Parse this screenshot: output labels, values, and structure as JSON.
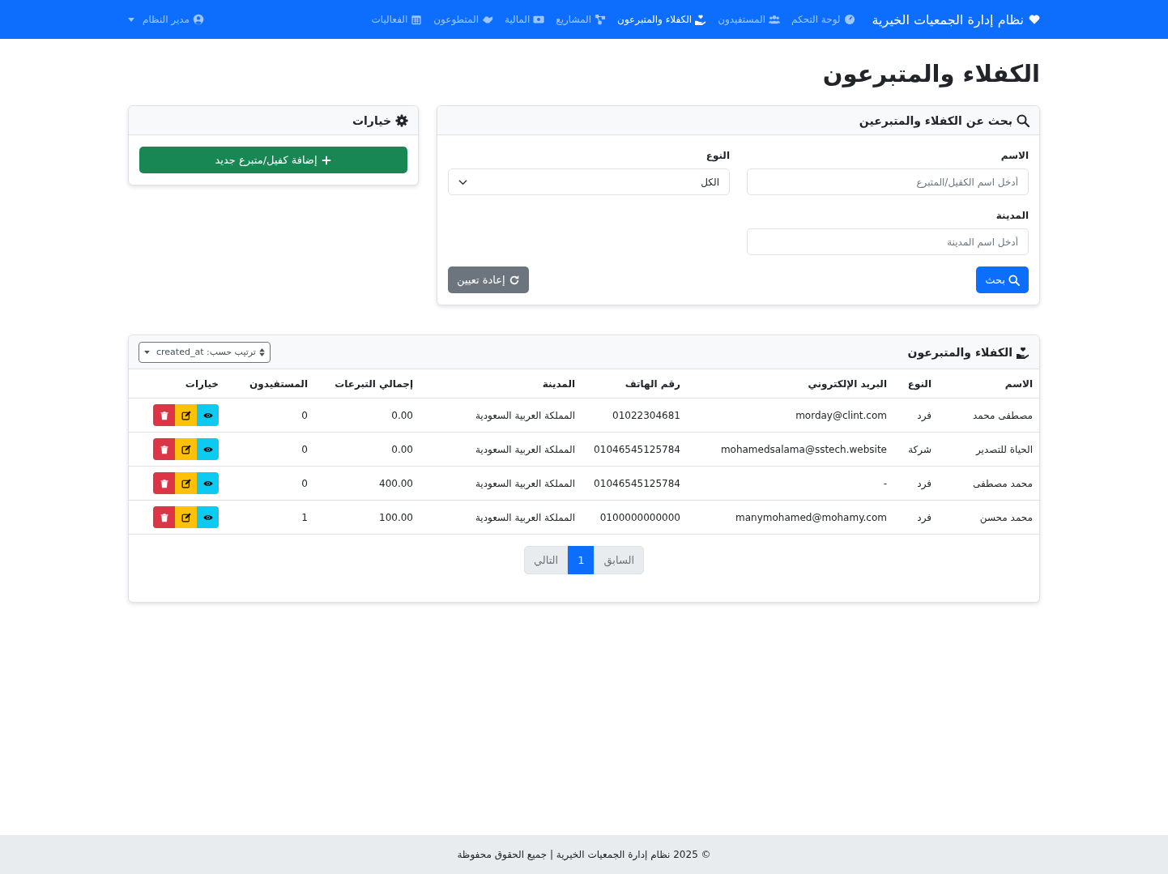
{
  "navbar": {
    "brand": "نظام إدارة الجمعيات الخيرية",
    "items": [
      {
        "label": "لوحة التحكم",
        "selected": false
      },
      {
        "label": "المستفيدون",
        "selected": false
      },
      {
        "label": "الكفلاء والمتبرعون",
        "selected": true
      },
      {
        "label": "المشاريع",
        "selected": false
      },
      {
        "label": "المالية",
        "selected": false
      },
      {
        "label": "المتطوعون",
        "selected": false
      },
      {
        "label": "الفعاليات",
        "selected": false
      }
    ],
    "user": "مدير النظام"
  },
  "page_title": "الكفلاء والمتبرعون",
  "search_card": {
    "title": "بحث عن الكفلاء والمتبرعين",
    "name_field": {
      "label": "الاسم",
      "placeholder": "أدخل اسم الكفيل/المتبرع"
    },
    "type_field": {
      "label": "النوع",
      "value": "الكل"
    },
    "city_field": {
      "label": "المدينة",
      "placeholder": "أدخل اسم المدينة"
    },
    "search_button": "بحث",
    "reset_button": "إعادة تعيين"
  },
  "options_card": {
    "title": "خيارات",
    "add_button": "إضافة كفيل/متبرع جديد"
  },
  "table_card": {
    "title": "الكفلاء والمتبرعون",
    "sort_select": "ترتيب حسب: created_at",
    "columns": [
      "الاسم",
      "النوع",
      "البريد الإلكتروني",
      "رقم الهاتف",
      "المدينة",
      "إجمالي التبرعات",
      "المستفيدون",
      "خيارات"
    ],
    "rows": [
      {
        "name": "مصطفى محمد",
        "type": "فرد",
        "email": "morday@clint.com",
        "phone": "01022304681",
        "city": "المملكة العربية السعودية",
        "total": "0.00",
        "beneficiaries": "0"
      },
      {
        "name": "الحياة للتصدير",
        "type": "شركة",
        "email": "mohamedsalama@sstech.website",
        "phone": "01046545125784",
        "city": "المملكة العربية السعودية",
        "total": "0.00",
        "beneficiaries": "0"
      },
      {
        "name": "محمد مصطفى",
        "type": "فرد",
        "email": "-",
        "phone": "01046545125784",
        "city": "المملكة العربية السعودية",
        "total": "400.00",
        "beneficiaries": "0"
      },
      {
        "name": "محمد محسن",
        "type": "فرد",
        "email": "manymohamed@mohamy.com",
        "phone": "0100000000000",
        "city": "المملكة العربية السعودية",
        "total": "100.00",
        "beneficiaries": "1"
      }
    ],
    "pagination": [
      {
        "label": "السابق",
        "selected": false
      },
      {
        "label": "1",
        "selected": true
      },
      {
        "label": "التالي",
        "selected": false
      }
    ]
  },
  "footer": "© 2025 نظام إدارة الجمعيات الخيرية | جميع الحقوق محفوظة"
}
